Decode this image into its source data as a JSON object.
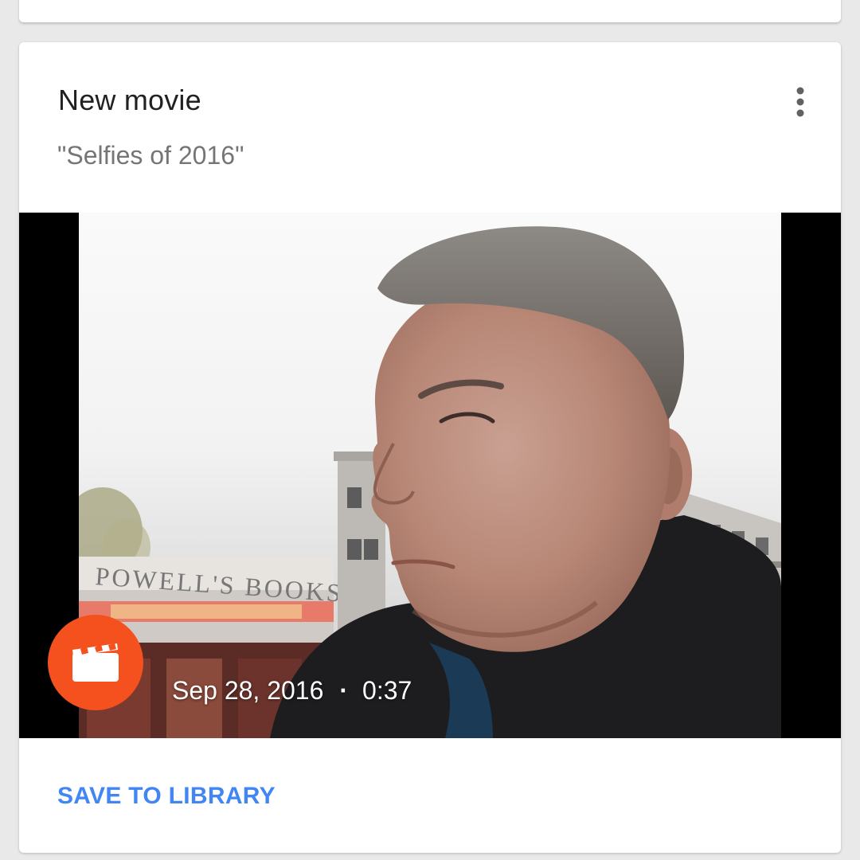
{
  "card": {
    "title": "New movie",
    "subtitle": "\"Selfies of 2016\"",
    "menu_icon": "more-vert-icon",
    "media": {
      "date": "Sep 28, 2016",
      "separator": "·",
      "duration": "0:37",
      "badge_icon": "movie-clapperboard-icon",
      "badge_color": "#f4511e",
      "sign_text": "POWELL'S BOOKS"
    },
    "action_label": "SAVE TO LIBRARY",
    "action_color": "#4285f4"
  }
}
